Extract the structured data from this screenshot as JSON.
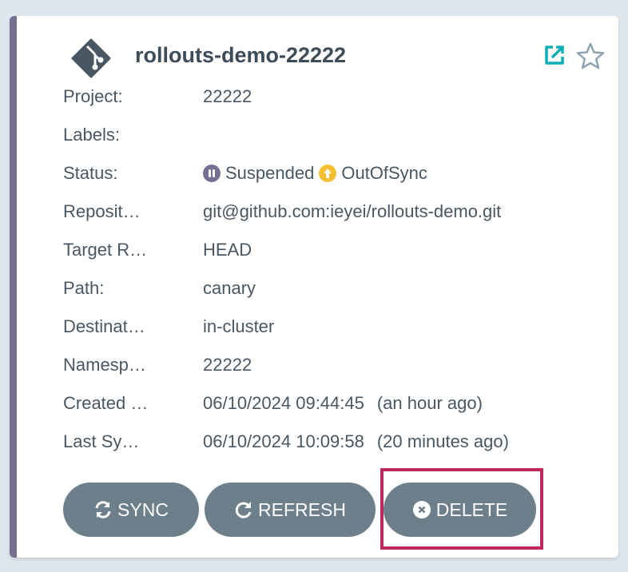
{
  "app": {
    "name": "rollouts-demo-22222",
    "fields": [
      {
        "label": "Project:",
        "value": "22222"
      },
      {
        "label": "Labels:",
        "value": ""
      },
      {
        "label": "Status:",
        "health": "Suspended",
        "sync": "OutOfSync"
      },
      {
        "label": "Reposit…",
        "value": "git@github.com:ieyei/rollouts-demo.git"
      },
      {
        "label": "Target R…",
        "value": "HEAD"
      },
      {
        "label": "Path:",
        "value": "canary"
      },
      {
        "label": "Destinat…",
        "value": "in-cluster"
      },
      {
        "label": "Namesp…",
        "value": "22222"
      },
      {
        "label": "Created …",
        "value": "06/10/2024 09:44:45",
        "ago": "(an hour ago)"
      },
      {
        "label": "Last Sy…",
        "value": "06/10/2024 10:09:58",
        "ago": "(20 minutes ago)"
      }
    ]
  },
  "actions": {
    "sync": "SYNC",
    "refresh": "REFRESH",
    "delete": "DELETE"
  },
  "colors": {
    "accent": "#766f94",
    "suspended": "#766f94",
    "outofsync": "#f4c030",
    "button": "#6d7f8b",
    "highlight": "#c0285a",
    "link": "#0dadb8"
  }
}
